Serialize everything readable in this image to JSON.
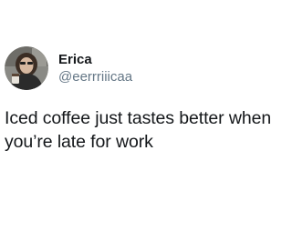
{
  "tweet": {
    "author": {
      "display_name": "Erica",
      "handle": "@eerrriiicaa",
      "avatar_icon": "profile-photo"
    },
    "text_lines": [
      "Iced coffee just tastes better when",
      "you’re late for work"
    ]
  },
  "colors": {
    "background": "#ffffff",
    "name": "#14171a",
    "handle": "#657786",
    "text": "#14171a"
  }
}
